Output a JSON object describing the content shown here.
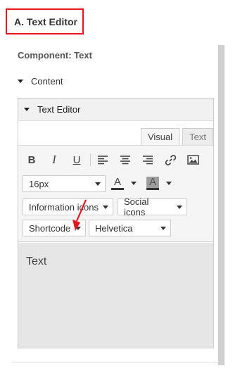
{
  "section": {
    "heading": "A. Text Editor"
  },
  "component": {
    "title": "Component: Text"
  },
  "content_group": {
    "label": "Content"
  },
  "editor": {
    "header_label": "Text Editor",
    "tabs": [
      {
        "label": "Visual",
        "active": true
      },
      {
        "label": "Text",
        "active": false
      }
    ],
    "toolbar": {
      "buttons": [
        {
          "label": "B",
          "icon": "bold-icon"
        },
        {
          "label": "I",
          "icon": "italic-icon"
        },
        {
          "label": "U",
          "icon": "underline-icon"
        },
        {
          "icon": "align-left-icon"
        },
        {
          "icon": "align-center-icon"
        },
        {
          "icon": "align-right-icon"
        },
        {
          "icon": "link-icon"
        },
        {
          "icon": "image-icon"
        }
      ],
      "font_size": "16px",
      "text_color_label": "A",
      "background_color_label": "A",
      "information_icons": "Information icons",
      "social_icons": "Social icons",
      "shortcode": "Shortcode",
      "font_family": "Helvetica"
    },
    "content_text": "Text"
  },
  "colors": {
    "highlight": "#e8141f",
    "arrow": "#e8141f"
  }
}
